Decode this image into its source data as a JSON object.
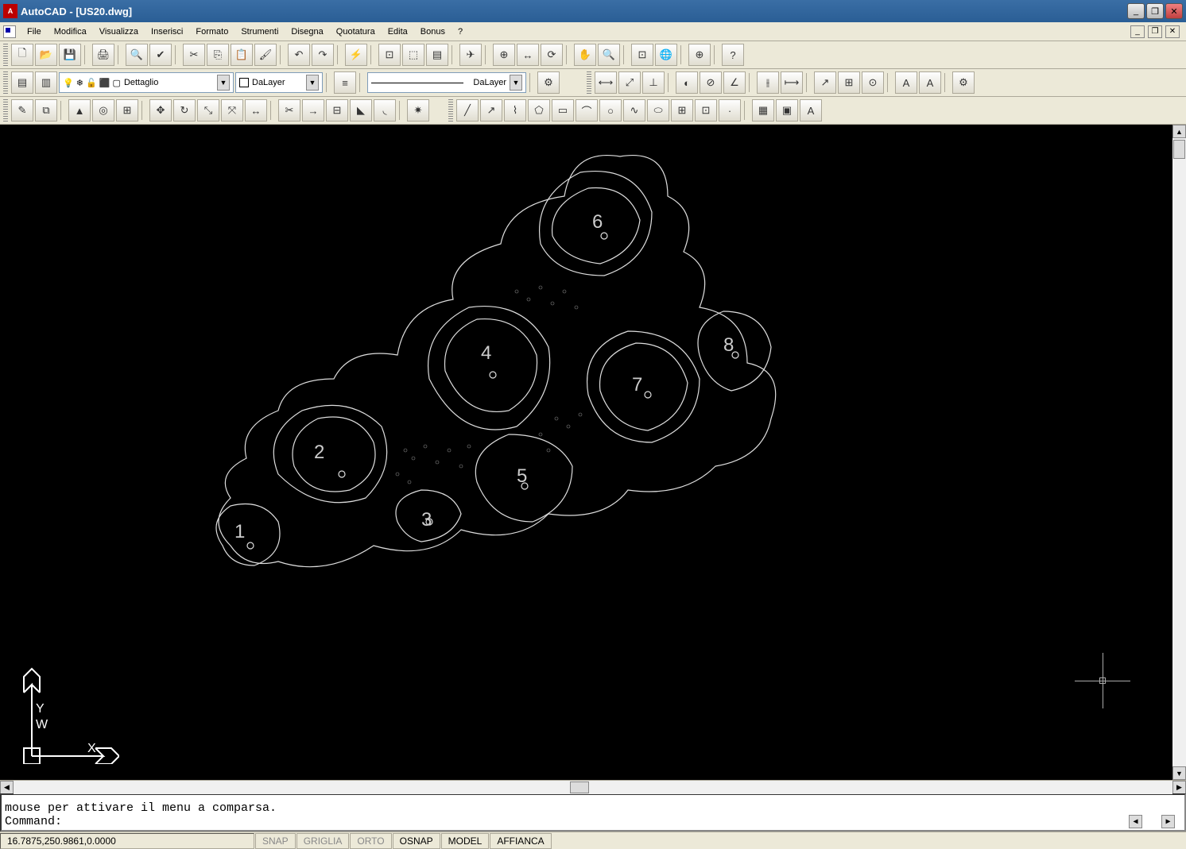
{
  "title": "AutoCAD - [US20.dwg]",
  "menu": [
    "File",
    "Modifica",
    "Visualizza",
    "Inserisci",
    "Formato",
    "Strumenti",
    "Disegna",
    "Quotatura",
    "Edita",
    "Bonus",
    "?"
  ],
  "layer": {
    "current": "Dettaglio",
    "color_label": "DaLayer",
    "linetype_label": "DaLayer"
  },
  "command": {
    "history_line": "mouse per attivare il menu a comparsa.",
    "prompt": "Command:"
  },
  "status": {
    "coords": "16.7875,250.9861,0.0000",
    "toggles": [
      "SNAP",
      "GRIGLIA",
      "ORTO",
      "OSNAP",
      "MODEL",
      "AFFIANCA"
    ],
    "toggle_active": [
      false,
      false,
      false,
      true,
      true,
      true
    ]
  },
  "drawing_labels": [
    "1",
    "2",
    "3",
    "4",
    "5",
    "6",
    "7",
    "8"
  ],
  "ucs": {
    "x": "X",
    "y": "Y",
    "w": "W"
  },
  "toolbar_icons": {
    "row1": [
      "new",
      "open",
      "save",
      "print",
      "preview",
      "spell",
      "cut",
      "copy",
      "paste",
      "match",
      "undo",
      "redo",
      "launch",
      "pan",
      "pan-rt",
      "hatch",
      "layers",
      "snap",
      "dist",
      "xline",
      "zoom-win",
      "zoom-prev",
      "zoom-all",
      "help",
      "help2"
    ],
    "row2_left": [
      "layer-1",
      "layer-2"
    ],
    "row2_right": [
      "prop",
      "dim1",
      "dim2",
      "dim3",
      "ucs1",
      "ucs2",
      "ucs3",
      "br1",
      "br2",
      "br3",
      "br4",
      "br5",
      "a1",
      "a2",
      "a3"
    ],
    "row3": [
      "ed1",
      "ed2",
      "mir",
      "arr",
      "grid4",
      "move",
      "rot",
      "scale",
      "stretch",
      "trim",
      "ext",
      "break",
      "fillet",
      "chamf",
      "expl",
      "line",
      "xln",
      "pline",
      "arc",
      "circ",
      "rect",
      "curve",
      "don",
      "wave",
      "ell",
      "blk",
      "blk2",
      "dd",
      "hatch2",
      "cam",
      "text"
    ]
  }
}
